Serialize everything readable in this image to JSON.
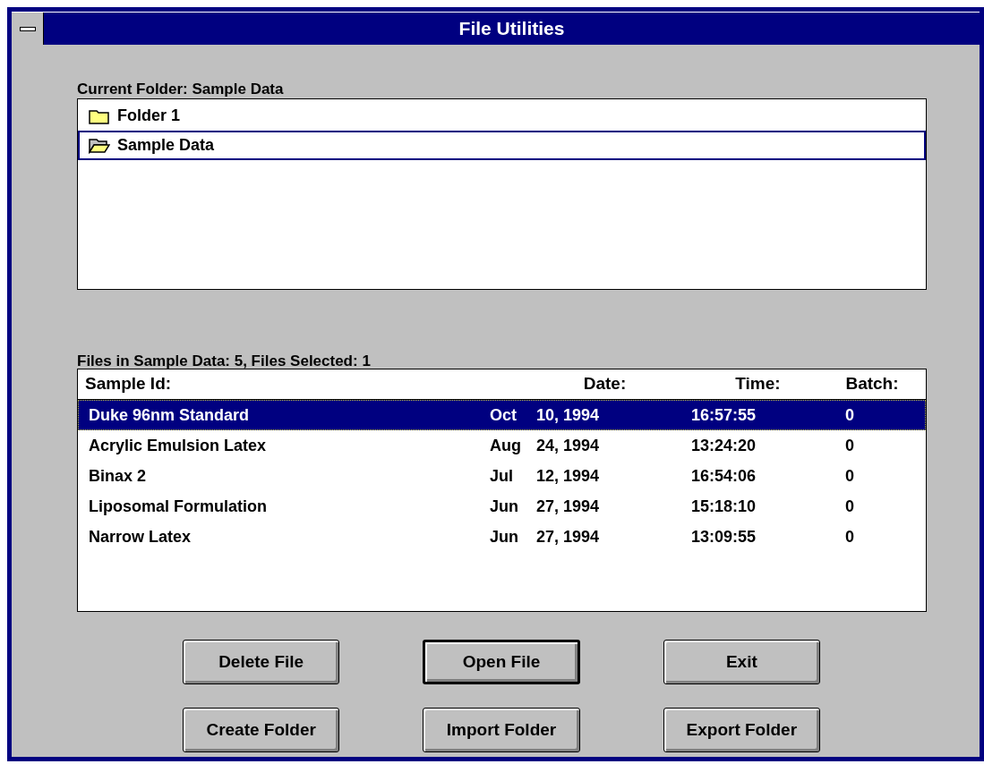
{
  "window": {
    "title": "File Utilities"
  },
  "folders": {
    "label": "Current Folder: Sample Data",
    "items": [
      {
        "name": "Folder 1",
        "kind": "closed",
        "selected": false
      },
      {
        "name": "Sample Data",
        "kind": "open",
        "selected": true
      }
    ]
  },
  "files": {
    "label": "Files in Sample Data: 5, Files Selected: 1",
    "columns": [
      "Sample Id:",
      "Date:",
      "Time:",
      "Batch:"
    ],
    "rows": [
      {
        "sample_id": "Duke 96nm Standard",
        "month": "Oct",
        "day": "10, 1994",
        "time": "16:57:55",
        "batch": "0",
        "selected": true
      },
      {
        "sample_id": "Acrylic Emulsion Latex",
        "month": "Aug",
        "day": "24, 1994",
        "time": "13:24:20",
        "batch": "0",
        "selected": false
      },
      {
        "sample_id": "Binax 2",
        "month": "Jul",
        "day": "12, 1994",
        "time": "16:54:06",
        "batch": "0",
        "selected": false
      },
      {
        "sample_id": "Liposomal Formulation",
        "month": "Jun",
        "day": "27, 1994",
        "time": "15:18:10",
        "batch": "0",
        "selected": false
      },
      {
        "sample_id": "Narrow Latex",
        "month": "Jun",
        "day": "27, 1994",
        "time": "13:09:55",
        "batch": "0",
        "selected": false
      }
    ]
  },
  "buttons": [
    {
      "label": "Delete File",
      "default": false
    },
    {
      "label": "Open File",
      "default": true
    },
    {
      "label": "Exit",
      "default": false
    },
    {
      "label": "Create Folder",
      "default": false
    },
    {
      "label": "Import Folder",
      "default": false
    },
    {
      "label": "Export Folder",
      "default": false
    }
  ]
}
